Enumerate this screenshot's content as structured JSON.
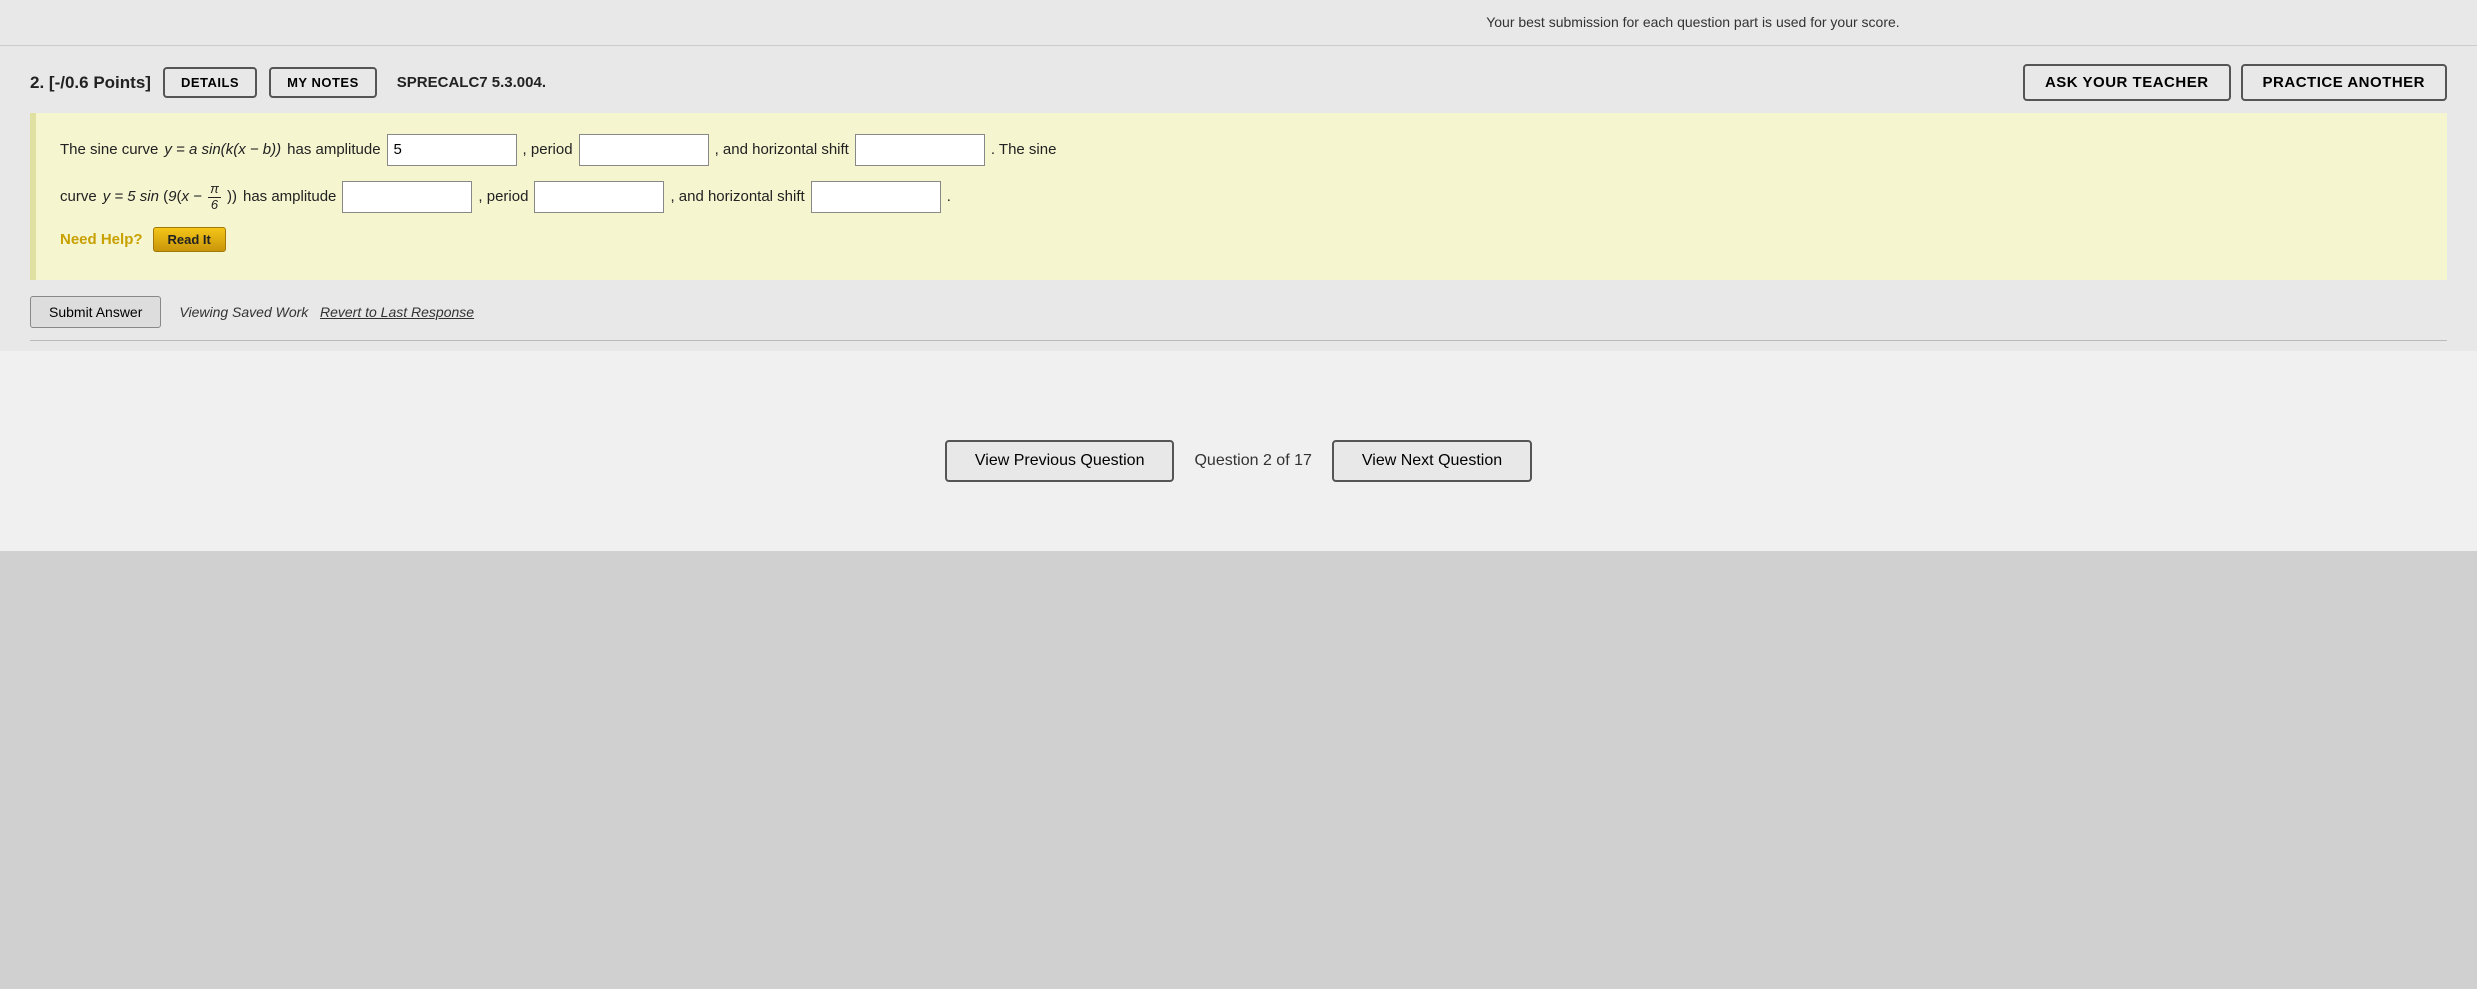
{
  "top_bar": {
    "text": "Your best submission for each question part is used for your score."
  },
  "question": {
    "number": "2.",
    "points": "[-/0.6 Points]",
    "details_label": "DETAILS",
    "my_notes_label": "MY NOTES",
    "sprecalc_label": "SPRECALC7 5.3.004.",
    "ask_teacher_label": "ASK YOUR TEACHER",
    "practice_another_label": "PRACTICE ANOTHER",
    "body_line1_pre": "The sine curve",
    "body_line1_eq": "y = a sin(k(x − b))",
    "body_line1_mid": "has amplitude",
    "amplitude1_value": "5",
    "period_label": ", period",
    "horizontal_shift_label": ", and horizontal shift",
    "line1_suffix": ". The sine",
    "body_line2_pre": "curve",
    "body_line2_eq_pre": "y = 5 sin",
    "body_line2_paren": "9",
    "body_line2_fraction_num": "π",
    "body_line2_fraction_den": "6",
    "body_line2_has": "has amplitude",
    "period_label2": ", period",
    "horizontal_shift_label2": ", and horizontal shift",
    "line2_suffix": ".",
    "need_help_label": "Need Help?",
    "read_it_label": "Read It",
    "submit_label": "Submit Answer",
    "saved_work_text": "Viewing Saved Work",
    "revert_link": "Revert to Last Response"
  },
  "navigation": {
    "view_previous": "View Previous Question",
    "question_counter": "Question 2 of 17",
    "view_next": "View Next Question"
  }
}
